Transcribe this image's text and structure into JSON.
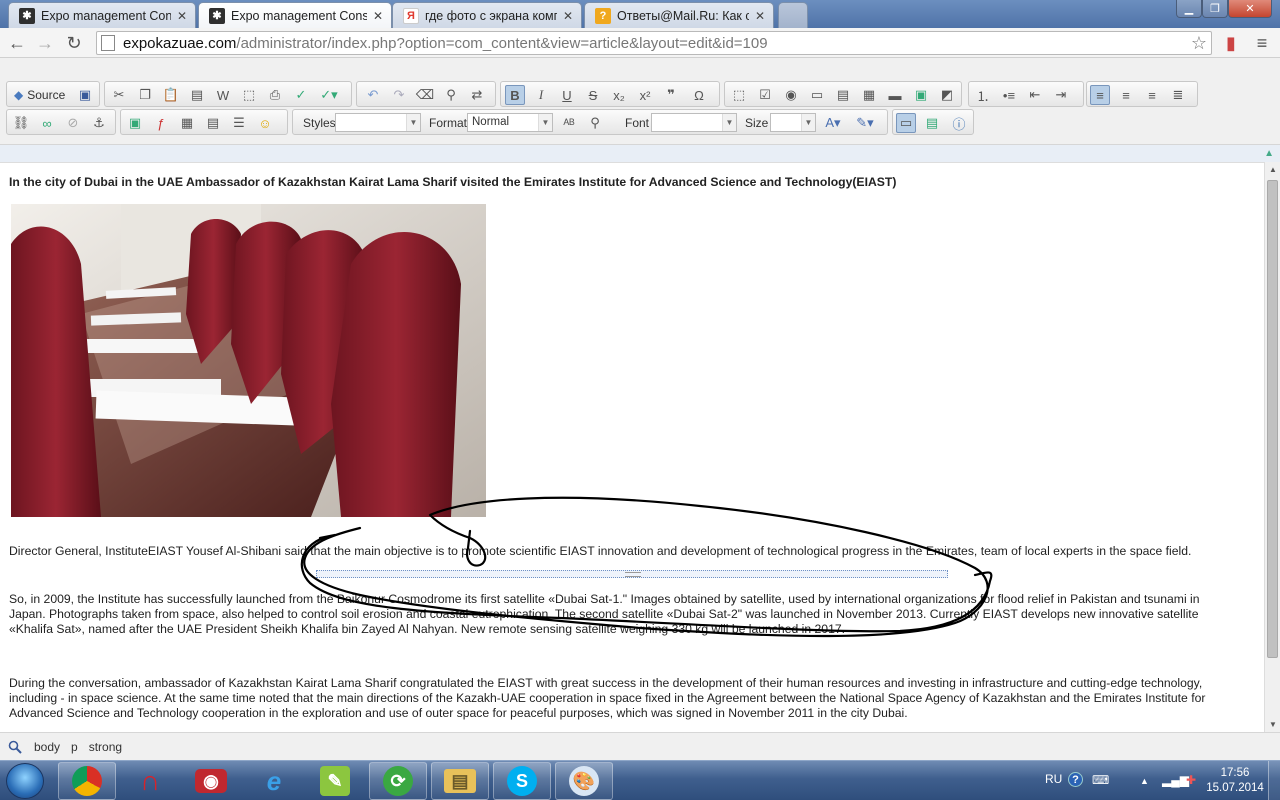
{
  "browser": {
    "tabs": [
      {
        "title": "Expo management Consu",
        "icon": "joomla-icon",
        "active": false
      },
      {
        "title": "Expo management Consu",
        "icon": "joomla-icon",
        "active": true
      },
      {
        "title": "где фото с экрана компь",
        "icon": "yandex-icon",
        "active": false
      },
      {
        "title": "Ответы@Mail.Ru: Как сде",
        "icon": "mailru-answers-icon",
        "active": false
      }
    ],
    "url_host": "expokazuae.com",
    "url_path": "/administrator/index.php?option=com_content&view=article&layout=edit&id=109"
  },
  "editor": {
    "source_label": "Source",
    "styles_label": "Styles",
    "format_label": "Format",
    "format_value": "Normal",
    "font_label": "Font",
    "size_label": "Size",
    "styles_value": "",
    "font_value": "",
    "size_value": ""
  },
  "article": {
    "heading": "In the city of Dubai in the UAE Ambassador of Kazakhstan Kairat Lama Sharif visited the Emirates Institute for Advanced Science and Technology(EIAST)",
    "p1": "Director General, InstituteEIAST Yousef Al-Shibani said that the main objective is to promote scientific EIAST innovation and development of technological progress in the Emirates, team of local experts in the space field.",
    "p2": "So, in 2009, the Institute has successfully launched from the Baikonur Cosmodrome its first satellite «Dubai Sat-1.\" Images obtained by satellite, used by international organizations for flood relief in Pakistan and tsunami in Japan. Photographs taken from space, also helped to control soil erosion and coastal eutrophication. The second satellite «Dubai Sat-2\" was launched in November 2013. Currently EIAST develops new innovative satellite «Khalifa Sat», named after the UAE President Sheikh Khalifa bin Zayed Al Nahyan. New remote sensing satellite weighing 330 kg will be launched in 2017.",
    "p3": "During the conversation, ambassador of Kazakhstan Kairat Lama Sharif congratulated the EIAST with great success in the development of their human resources and investing in infrastructure and cutting-edge technology, including - in space science. At the same time noted that the main directions of the Kazakh-UAE cooperation in space fixed in the Agreement between the National Space Agency of Kazakhstan and the Emirates Institute for Advanced Science and Technology cooperation in the exploration and use of outer space for peaceful purposes, which was signed in November 2011 in the city Dubai."
  },
  "element_path": [
    "body",
    "p",
    "strong"
  ],
  "taskbar": {
    "apps": [
      "chrome-icon",
      "app-n-icon",
      "camera-icon",
      "internet-explorer-icon",
      "notepad-plus-icon",
      "refresh-app-icon",
      "explorer-folder-icon",
      "skype-icon",
      "paint-icon"
    ],
    "lang": "RU",
    "time": "17:56",
    "date": "15.07.2014"
  },
  "colors": {
    "accent": "#4f73a8",
    "scribble": "#000000",
    "chair": "#8e1f2a"
  }
}
